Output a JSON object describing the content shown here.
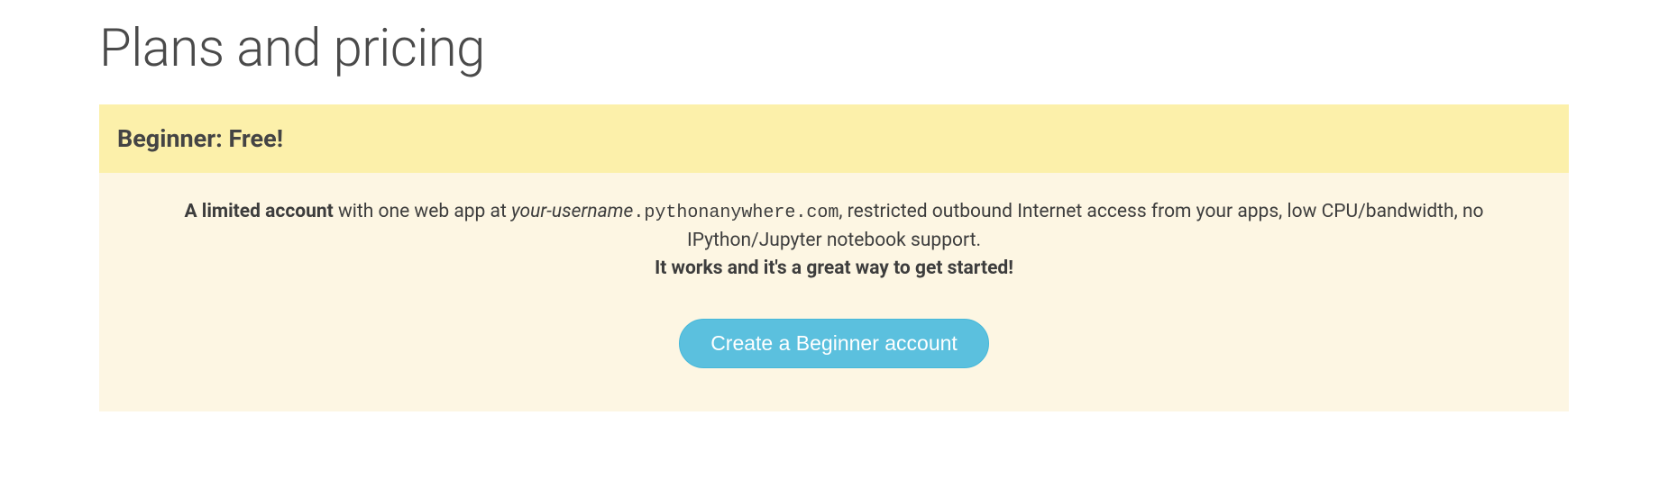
{
  "page": {
    "title": "Plans and pricing"
  },
  "plan": {
    "header_title": "Beginner: Free!",
    "description": {
      "lead_bold": "A limited account",
      "text_1": " with one web app at ",
      "username_italic": "your-username",
      "domain_code": ".pythonanywhere.com",
      "text_2": ", restricted outbound Internet access from your apps, low CPU/bandwidth, no IPython/Jupyter notebook support.",
      "tagline_bold": "It works and it's a great way to get started!"
    },
    "cta_label": "Create a Beginner account"
  }
}
